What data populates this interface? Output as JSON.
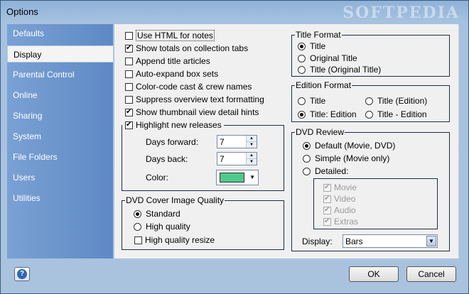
{
  "window": {
    "title": "Options",
    "watermark": "SOFTPEDIA"
  },
  "sidebar": {
    "items": [
      {
        "label": "Defaults",
        "active": false
      },
      {
        "label": "Display",
        "active": true
      },
      {
        "label": "Parental Control",
        "active": false
      },
      {
        "label": "Online",
        "active": false
      },
      {
        "label": "Sharing",
        "active": false
      },
      {
        "label": "System",
        "active": false
      },
      {
        "label": "File Folders",
        "active": false
      },
      {
        "label": "Users",
        "active": false
      },
      {
        "label": "Utilities",
        "active": false
      }
    ]
  },
  "display": {
    "checkboxes": [
      {
        "label": "Use HTML for notes",
        "checked": false
      },
      {
        "label": "Show totals on collection tabs",
        "checked": true
      },
      {
        "label": "Append title articles",
        "checked": false
      },
      {
        "label": "Auto-expand box sets",
        "checked": false
      },
      {
        "label": "Color-code cast & crew names",
        "checked": false
      },
      {
        "label": "Suppress overview text formatting",
        "checked": false
      },
      {
        "label": "Show thumbnail view detail hints",
        "checked": true
      },
      {
        "label": "Highlight new releases",
        "checked": true
      }
    ],
    "highlight": {
      "days_forward_label": "Days forward:",
      "days_forward_value": "7",
      "days_back_label": "Days back:",
      "days_back_value": "7",
      "color_label": "Color:",
      "color_value": "#4fc98b"
    },
    "cover_quality": {
      "legend": "DVD Cover Image Quality",
      "options": [
        {
          "label": "Standard",
          "selected": true
        },
        {
          "label": "High quality",
          "selected": false
        }
      ],
      "resize_label": "High quality resize",
      "resize_checked": false
    },
    "title_format": {
      "legend": "Title Format",
      "options": [
        {
          "label": "Title",
          "selected": true
        },
        {
          "label": "Original Title",
          "selected": false
        },
        {
          "label": "Title (Original Title)",
          "selected": false
        }
      ]
    },
    "edition_format": {
      "legend": "Edition Format",
      "options": [
        {
          "label": "Title",
          "selected": false
        },
        {
          "label": "Title (Edition)",
          "selected": false
        },
        {
          "label": "Title: Edition",
          "selected": true
        },
        {
          "label": "Title - Edition",
          "selected": false
        }
      ]
    },
    "dvd_review": {
      "legend": "DVD Review",
      "options": [
        {
          "label": "Default (Movie, DVD)",
          "selected": true
        },
        {
          "label": "Simple (Movie only)",
          "selected": false
        },
        {
          "label": "Detailed:",
          "selected": false
        }
      ],
      "detailed_items": [
        {
          "label": "Movie",
          "checked": true
        },
        {
          "label": "Video",
          "checked": true
        },
        {
          "label": "Audio",
          "checked": true
        },
        {
          "label": "Extras",
          "checked": true
        }
      ],
      "display_label": "Display:",
      "display_value": "Bars"
    }
  },
  "footer": {
    "ok_label": "OK",
    "cancel_label": "Cancel",
    "help_glyph": "?"
  }
}
